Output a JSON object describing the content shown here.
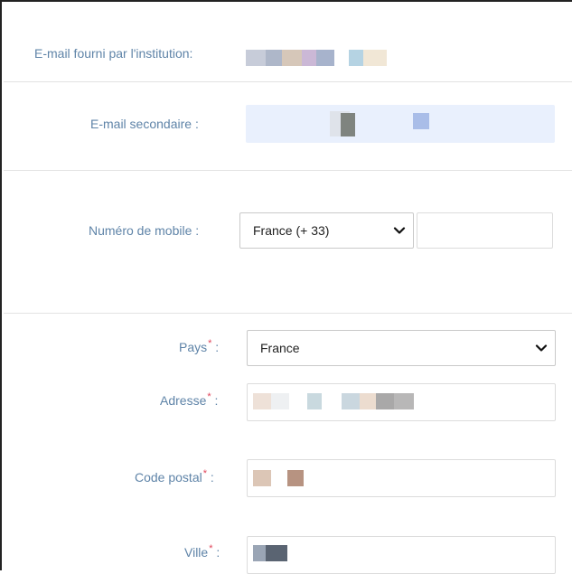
{
  "fields": {
    "institution_email": {
      "label": "E-mail fourni par l'institution:"
    },
    "secondary_email": {
      "label": "E-mail secondaire :"
    },
    "mobile": {
      "label": "Numéro de mobile :",
      "country_code_selected": "France (+ 33)",
      "number_value": ""
    },
    "country": {
      "label": "Pays",
      "required_mark": "*",
      "suffix": ":",
      "selected": "France"
    },
    "address": {
      "label": "Adresse",
      "required_mark": "*",
      "suffix": ":"
    },
    "postal_code": {
      "label": "Code postal",
      "required_mark": "*",
      "suffix": ":"
    },
    "city": {
      "label": "Ville",
      "required_mark": "*",
      "suffix": ":"
    }
  },
  "icons": {
    "dropdown": "chevron-down-icon"
  },
  "colors": {
    "label": "#5f84a8",
    "required": "#e0455a",
    "secondary_email_bg": "#e9f0fd"
  }
}
